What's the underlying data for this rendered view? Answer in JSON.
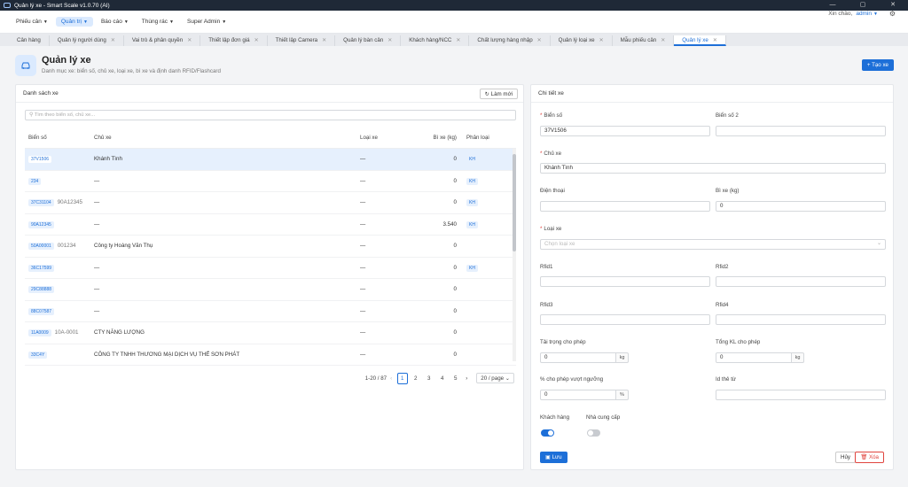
{
  "window": {
    "title": "Quản lý xe - Smart Scale v1.0.70 (AI)",
    "controls": [
      "—",
      "▢",
      "✕"
    ]
  },
  "menu": {
    "items": [
      "Phiếu cân",
      "Quản trị",
      "Báo cáo",
      "Thùng rác",
      "Super Admin"
    ],
    "active": "Quản trị",
    "greeting": "Xin chào,",
    "user": "admin"
  },
  "tabs": [
    "Cân hàng",
    "Quản lý người dùng",
    "Vai trò & phân quyền",
    "Thiết lập đơn giá",
    "Thiết lập Camera",
    "Quản lý bàn cân",
    "Khách hàng/NCC",
    "Chất lượng hàng nhập",
    "Quản lý loại xe",
    "Mẫu phiếu cân",
    "Quản lý xe"
  ],
  "active_tab": "Quản lý xe",
  "header": {
    "title": "Quản lý xe",
    "subtitle": "Danh mục xe: biển số, chủ xe, loại xe, bì xe và định danh RFID/Flashcard",
    "create_label": "+ Tạo xe"
  },
  "list": {
    "title": "Danh sách xe",
    "refresh_label": "Làm mới",
    "search_placeholder": "Tìm theo biển số, chủ xe...",
    "columns": [
      "Biển số",
      "Chủ xe",
      "Loại xe",
      "Bì xe (kg)",
      "Phân loại"
    ],
    "rows": [
      {
        "plate": "37V1506",
        "plate2": "",
        "owner": "Khánh Tình",
        "type": "—",
        "tare": "0",
        "cls": "KH"
      },
      {
        "plate": "234",
        "plate2": "",
        "owner": "—",
        "type": "—",
        "tare": "0",
        "cls": "KH"
      },
      {
        "plate": "37C31104",
        "plate2": "90A12345",
        "owner": "—",
        "type": "—",
        "tare": "0",
        "cls": "KH"
      },
      {
        "plate": "90A12345",
        "plate2": "",
        "owner": "—",
        "type": "—",
        "tare": "3.540",
        "cls": "KH"
      },
      {
        "plate": "50A00001",
        "plate2": "001234",
        "owner": "Công ty Hoàng Văn Thụ",
        "type": "—",
        "tare": "0",
        "cls": ""
      },
      {
        "plate": "36C17599",
        "plate2": "",
        "owner": "—",
        "type": "—",
        "tare": "0",
        "cls": "KH"
      },
      {
        "plate": "29C88888",
        "plate2": "",
        "owner": "—",
        "type": "—",
        "tare": "0",
        "cls": ""
      },
      {
        "plate": "88C07587",
        "plate2": "",
        "owner": "—",
        "type": "—",
        "tare": "0",
        "cls": ""
      },
      {
        "plate": "11A0009",
        "plate2": "10A-0001",
        "owner": "CTY NĂNG LƯỢNG",
        "type": "—",
        "tare": "0",
        "cls": ""
      },
      {
        "plate": "33C4Y",
        "plate2": "",
        "owner": "CÔNG TY TNHH THƯƠNG MẠI DỊCH VỤ THẾ SƠN PHÁT",
        "type": "—",
        "tare": "0",
        "cls": ""
      }
    ],
    "pagination": {
      "total": "1-20 / 87",
      "pages": [
        "1",
        "2",
        "3",
        "4",
        "5"
      ],
      "current": "1",
      "page_size": "20 / page"
    }
  },
  "detail": {
    "title": "Chi tiết xe",
    "fields": {
      "plate": {
        "label": "Biển số",
        "value": "37V1506"
      },
      "plate2": {
        "label": "Biển số 2",
        "value": ""
      },
      "owner": {
        "label": "Chủ xe",
        "value": "Khánh Tình"
      },
      "phone": {
        "label": "Điện thoại",
        "value": ""
      },
      "tare": {
        "label": "Bì xe (kg)",
        "value": "0"
      },
      "vtype": {
        "label": "Loại xe",
        "placeholder": "Chọn loại xe"
      },
      "rfid1": {
        "label": "Rfid1",
        "value": ""
      },
      "rfid2": {
        "label": "Rfid2",
        "value": ""
      },
      "rfid3": {
        "label": "Rfid3",
        "value": ""
      },
      "rfid4": {
        "label": "Rfid4",
        "value": ""
      },
      "load": {
        "label": "Tải trọng cho phép",
        "value": "0",
        "unit": "kg"
      },
      "gross": {
        "label": "Tổng KL cho phép",
        "value": "0",
        "unit": "kg"
      },
      "over": {
        "label": "% cho phép vượt ngưỡng",
        "value": "0",
        "unit": "%"
      },
      "card": {
        "label": "Id thẻ từ",
        "value": ""
      }
    },
    "toggles": {
      "customer": {
        "label": "Khách hàng",
        "on": true
      },
      "supplier": {
        "label": "Nhà cung cấp",
        "on": false
      }
    },
    "save_label": "Lưu",
    "cancel_label": "Hủy",
    "delete_label": "Xóa"
  },
  "colors": {
    "accent": "#1d6fd8",
    "danger": "#e0443e",
    "selected_row": "#e6f0fd"
  }
}
